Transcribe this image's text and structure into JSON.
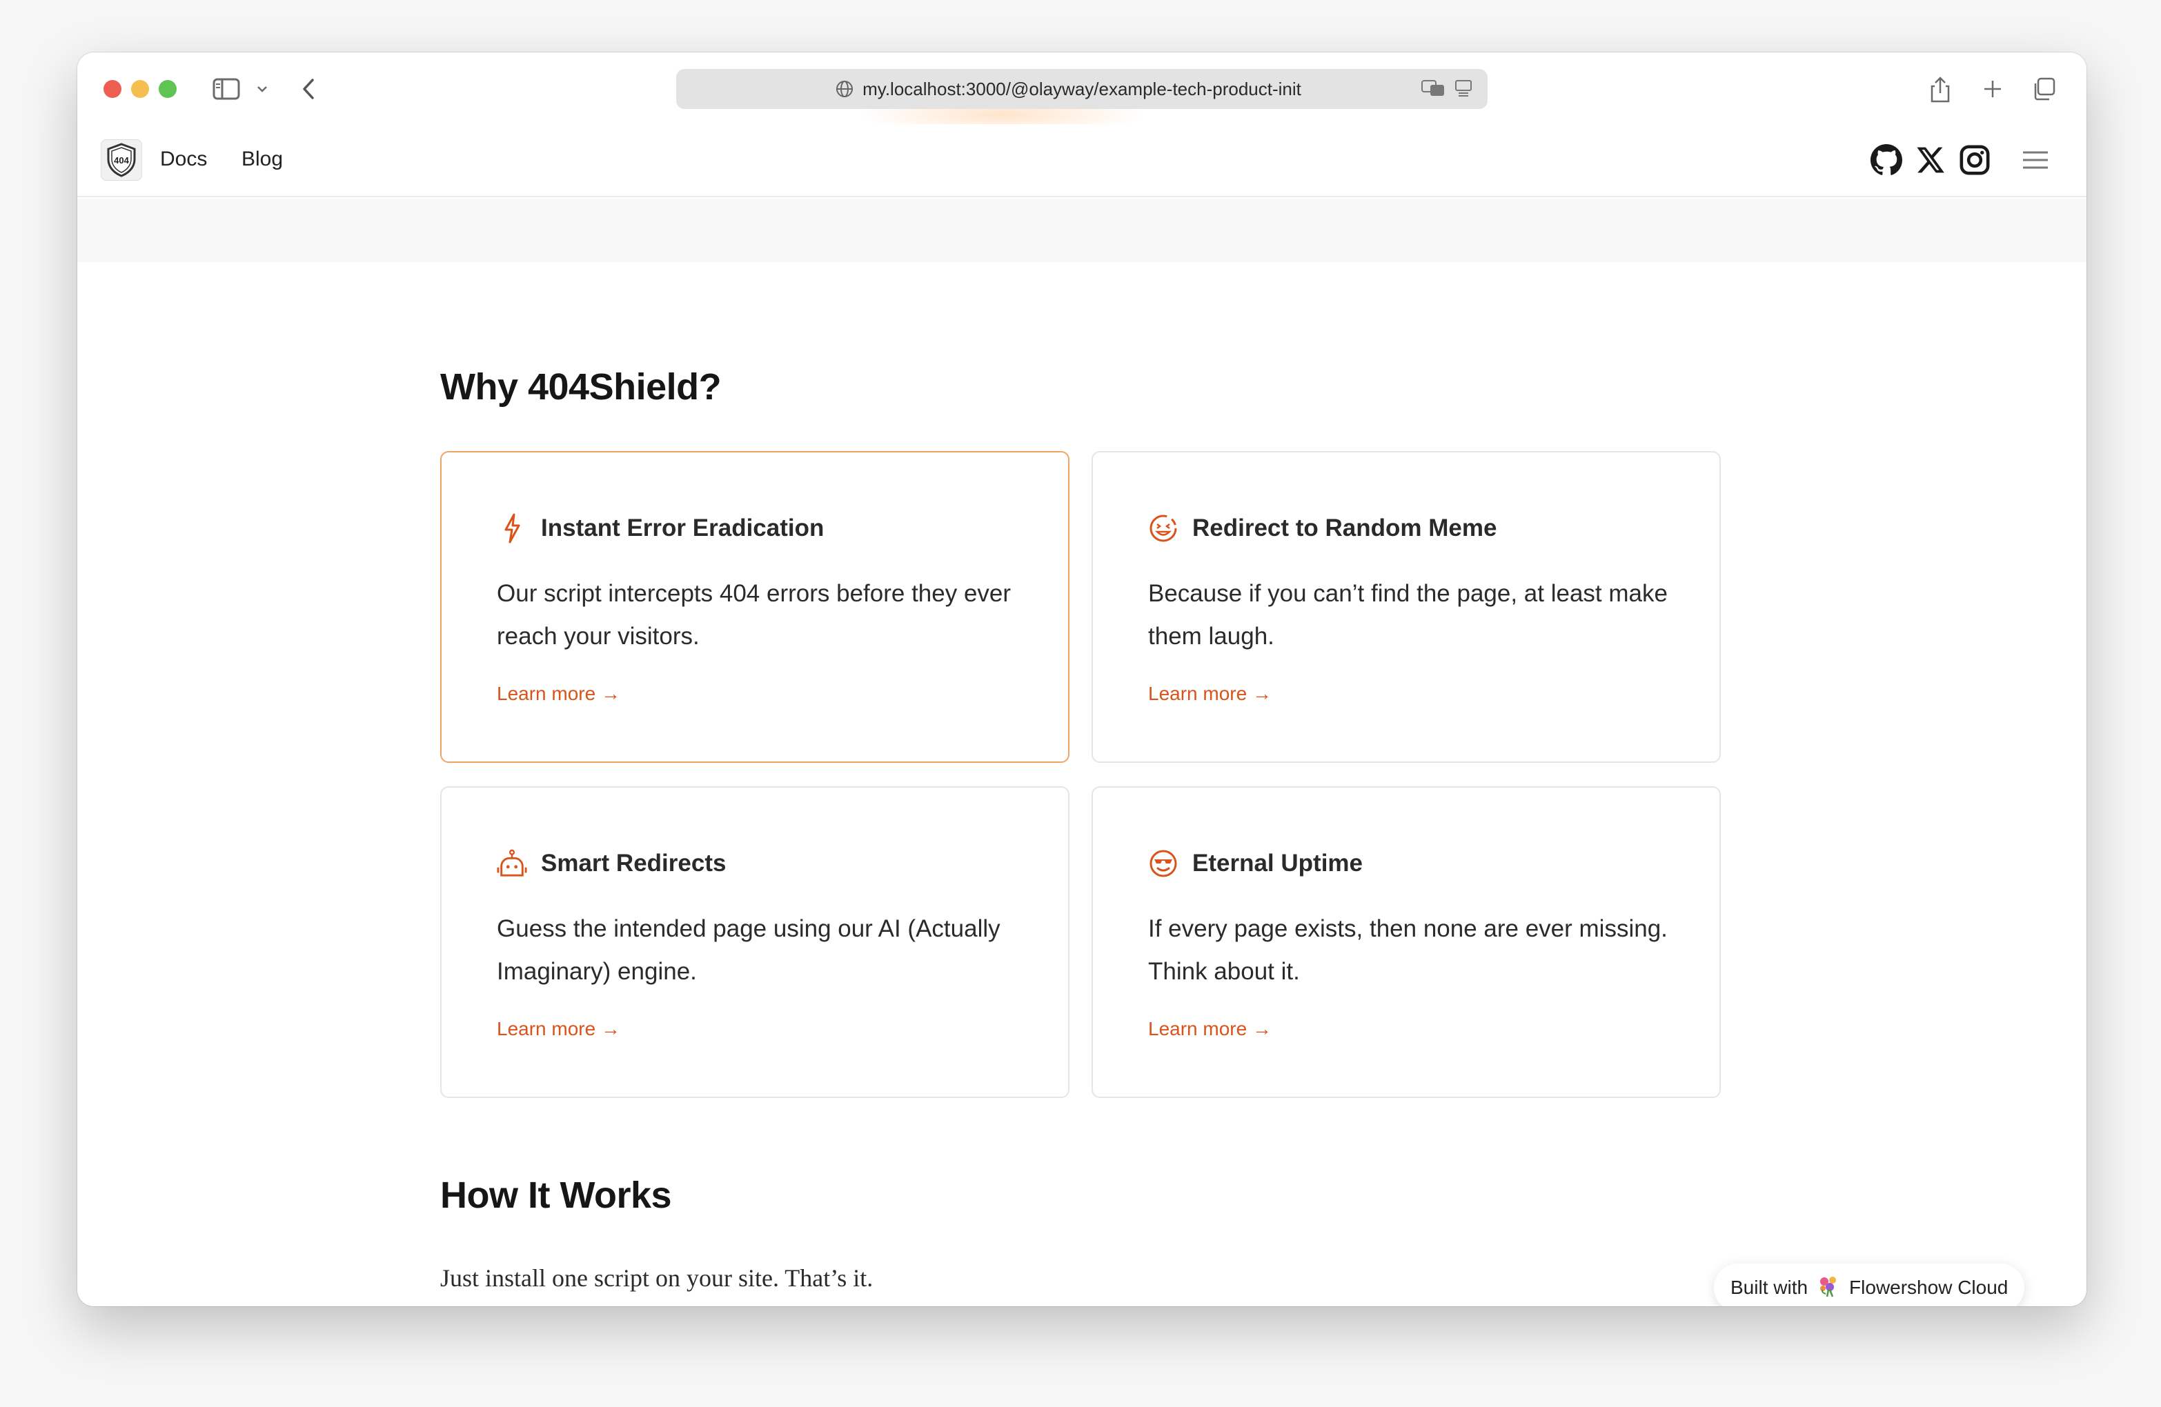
{
  "browser": {
    "url": "my.localhost:3000/@olayway/example-tech-product-init"
  },
  "site": {
    "logo_text": "404",
    "nav": [
      {
        "label": "Docs"
      },
      {
        "label": "Blog"
      }
    ],
    "social": [
      "github-icon",
      "x-icon",
      "instagram-icon"
    ]
  },
  "features": {
    "heading": "Why 404Shield?",
    "cards": [
      {
        "icon": "lightning-icon",
        "title": "Instant Error Eradication",
        "description": "Our script intercepts 404 errors before they ever reach your visitors.",
        "link": "Learn more →"
      },
      {
        "icon": "laugh-face-icon",
        "title": "Redirect to Random Meme",
        "description": "Because if you can’t find the page, at least make them laugh.",
        "link": "Learn more →"
      },
      {
        "icon": "robot-icon",
        "title": "Smart Redirects",
        "description": "Guess the intended page using our AI (Actually Imaginary) engine.",
        "link": "Learn more →"
      },
      {
        "icon": "cool-face-icon",
        "title": "Eternal Uptime",
        "description": "If every page exists, then none are ever missing. Think about it.",
        "link": "Learn more →"
      }
    ]
  },
  "how_it_works": {
    "heading": "How It Works",
    "text": "Just install one script on your site. That’s it."
  },
  "badge": {
    "prefix": "Built with",
    "product": "Flowershow Cloud"
  },
  "colors": {
    "accent": "#d9531a",
    "active_border": "#f0a463"
  }
}
